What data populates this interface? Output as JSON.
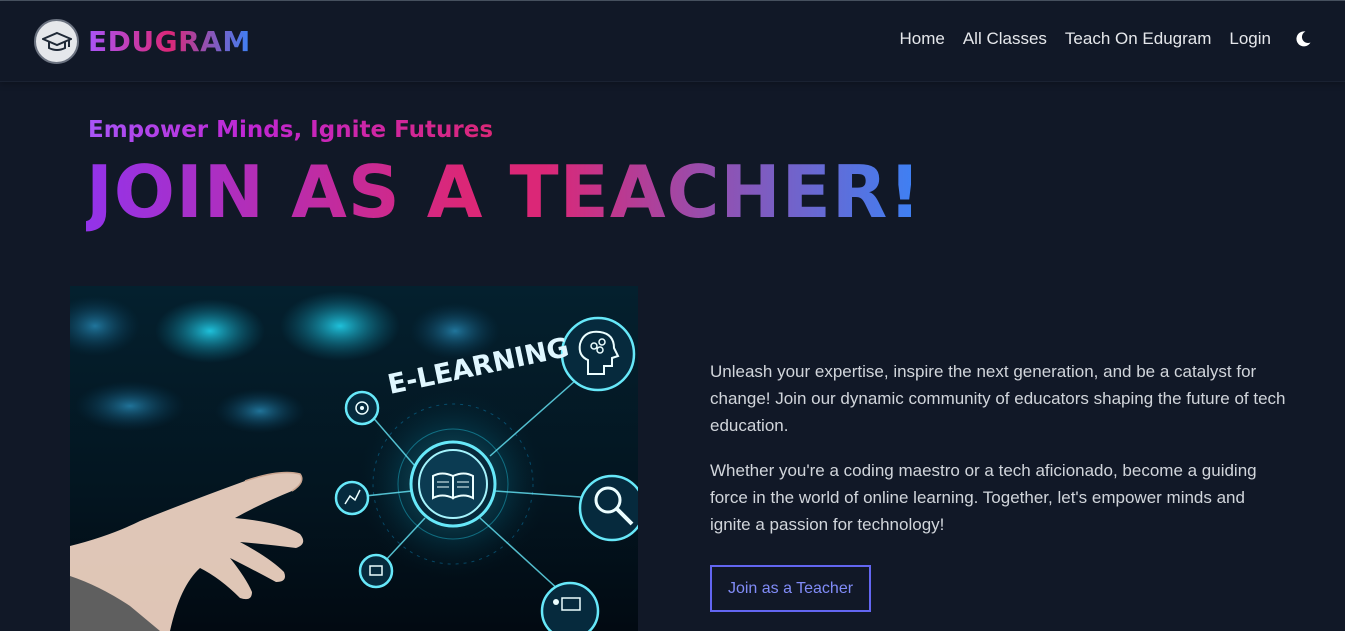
{
  "brand": {
    "name": "EDUGRAM",
    "logo_icon": "graduation-cap-icon"
  },
  "nav": {
    "items": [
      {
        "label": "Home"
      },
      {
        "label": "All Classes"
      },
      {
        "label": "Teach On Edugram"
      },
      {
        "label": "Login"
      }
    ],
    "theme_toggle_icon": "moon-icon"
  },
  "hero": {
    "tagline": "Empower Minds, Ignite Futures",
    "title": "JOIN AS A TEACHER!",
    "image_label": "E-LEARNING",
    "paragraphs": [
      "Unleash your expertise, inspire the next generation, and be a catalyst for change! Join our dynamic community of educators shaping the future of tech education.",
      "Whether you're a coding maestro or a tech aficionado, become a guiding force in the world of online learning. Together, let's empower minds and ignite a passion for technology!"
    ],
    "cta_label": "Join as a Teacher"
  },
  "colors": {
    "background": "#111827",
    "gradient_start": "#a855f7",
    "gradient_mid": "#db2777",
    "gradient_end": "#3b82f6",
    "cta_border": "#6366f1"
  }
}
